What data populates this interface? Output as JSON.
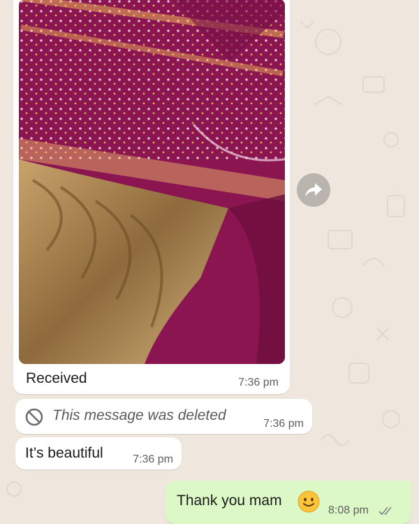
{
  "chat": {
    "messages": [
      {
        "direction": "incoming",
        "type": "image",
        "caption": "Received",
        "time": "7:36 pm"
      },
      {
        "direction": "incoming",
        "type": "deleted",
        "text": "This message was deleted",
        "time": "7:36 pm",
        "icon": "deleted-icon"
      },
      {
        "direction": "incoming",
        "type": "text",
        "text": "It’s beautiful",
        "time": "7:36 pm"
      },
      {
        "direction": "outgoing",
        "type": "text",
        "text": "Thank you mam",
        "emoji": "slightly-smiling-face",
        "time": "8:08 pm",
        "status": "sent"
      }
    ],
    "forward_icon": "forward-arrow-icon"
  },
  "colors": {
    "chat_background": "#efe7dd",
    "incoming_bubble": "#ffffff",
    "outgoing_bubble": "#dcf8c6",
    "forward_button": "#b9b4ad",
    "saree_magenta": "#8a1550",
    "saree_gold": "#b08a52"
  }
}
